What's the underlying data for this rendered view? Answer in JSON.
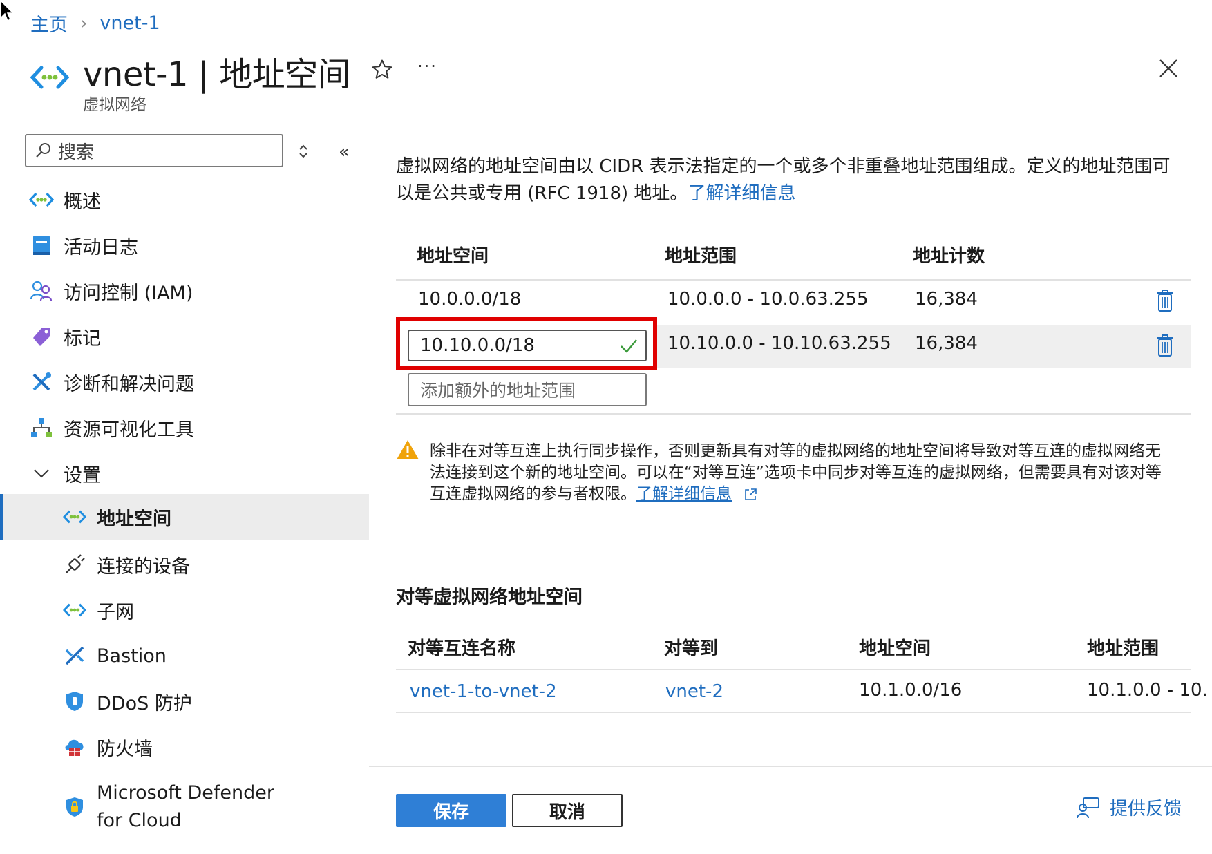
{
  "breadcrumb": {
    "home": "主页",
    "current": "vnet-1"
  },
  "header": {
    "title": "vnet-1 | 地址空间",
    "subtitle": "虚拟网络",
    "more": "···"
  },
  "sidebar": {
    "search_placeholder": "搜索",
    "collapse_glyph": "«",
    "items": [
      {
        "label": "概述",
        "icon": "vnet-icon"
      },
      {
        "label": "活动日志",
        "icon": "activity-log-icon"
      },
      {
        "label": "访问控制 (IAM)",
        "icon": "iam-icon"
      },
      {
        "label": "标记",
        "icon": "tag-icon"
      },
      {
        "label": "诊断和解决问题",
        "icon": "wrench-icon"
      },
      {
        "label": "资源可视化工具",
        "icon": "resource-visualizer-icon"
      },
      {
        "label": "设置",
        "icon": "chevron-down-icon"
      },
      {
        "label": "地址空间",
        "icon": "vnet-icon",
        "active": true
      },
      {
        "label": "连接的设备",
        "icon": "plug-icon"
      },
      {
        "label": "子网",
        "icon": "vnet-icon"
      },
      {
        "label": "Bastion",
        "icon": "bastion-icon"
      },
      {
        "label": "DDoS 防护",
        "icon": "shield-icon"
      },
      {
        "label": "防火墙",
        "icon": "firewall-icon"
      },
      {
        "label": "Microsoft Defender\nfor Cloud",
        "icon": "defender-icon"
      }
    ]
  },
  "main": {
    "description": "虚拟网络的地址空间由以 CIDR 表示法指定的一个或多个非重叠地址范围组成。定义的地址范围可以是公共或专用 (RFC 1918) 地址。",
    "learn_more": "了解详细信息",
    "address_table": {
      "headers": [
        "地址空间",
        "地址范围",
        "地址计数"
      ],
      "rows": [
        {
          "space": "10.0.0.0/18",
          "range": "10.0.0.0 - 10.0.63.255",
          "count": "16,384"
        },
        {
          "space": "10.10.0.0/18",
          "range": "10.10.0.0 - 10.10.63.255",
          "count": "16,384"
        }
      ],
      "add_placeholder": "添加额外的地址范围"
    },
    "warning": {
      "text": "除非在对等互连上执行同步操作，否则更新具有对等的虚拟网络的地址空间将导致对等互连的虚拟网络无法连接到这个新的地址空间。可以在“对等互连”选项卡中同步对等互连的虚拟网络，但需要具有对该对等互连虚拟网络的参与者权限。",
      "learn_more": "了解详细信息"
    },
    "peering": {
      "title": "对等虚拟网络地址空间",
      "headers": [
        "对等互连名称",
        "对等到",
        "地址空间",
        "地址范围"
      ],
      "rows": [
        {
          "name": "vnet-1-to-vnet-2",
          "peer": "vnet-2",
          "space": "10.1.0.0/16",
          "range": "10.1.0.0 - 10."
        }
      ]
    }
  },
  "footer": {
    "save": "保存",
    "cancel": "取消",
    "feedback": "提供反馈"
  },
  "colors": {
    "accent": "#1f6dbf",
    "primary_button": "#2f7fd6",
    "highlight": "#e00000",
    "warning": "#f0a30a"
  }
}
